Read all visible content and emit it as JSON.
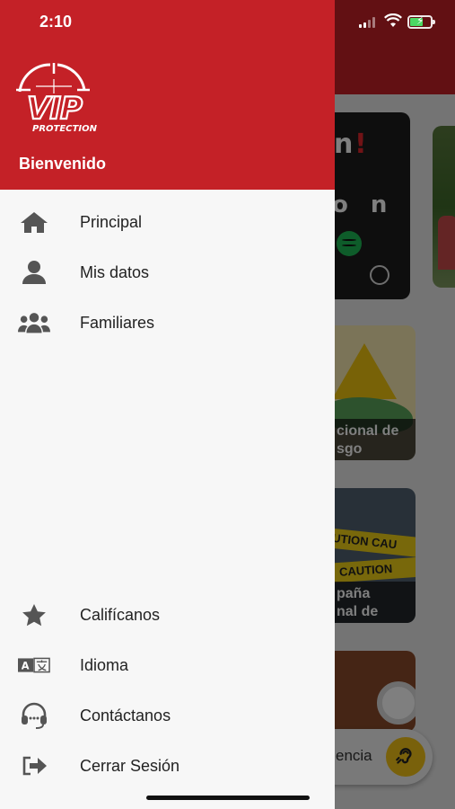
{
  "status_bar": {
    "time": "2:10"
  },
  "drawer": {
    "brand": {
      "logo_text": "VIP",
      "logo_subtext": "PROTECTION"
    },
    "welcome": "Bienvenido",
    "top_items": [
      {
        "label": "Principal",
        "icon": "home-icon"
      },
      {
        "label": "Mis datos",
        "icon": "user-icon"
      },
      {
        "label": "Familiares",
        "icon": "users-icon"
      }
    ],
    "bottom_items": [
      {
        "label": "Califícanos",
        "icon": "star-icon"
      },
      {
        "label": "Idioma",
        "icon": "language-icon"
      },
      {
        "label": "Contáctanos",
        "icon": "headset-icon"
      },
      {
        "label": "Cerrar Sesión",
        "icon": "logout-icon"
      }
    ]
  },
  "background": {
    "card1": {
      "line1": "n",
      "excl": "!",
      "line2": "o n"
    },
    "news": [
      {
        "caption_1": "cional de",
        "caption_2": "sgo"
      },
      {
        "caption_1": "paña",
        "caption_2": "nal de",
        "tape_1": "UTION CAU",
        "tape_2": "CAUTION"
      }
    ],
    "fab_label": "encia"
  },
  "colors": {
    "brand_red": "#c42127",
    "accent_yellow": "#f3c316"
  }
}
